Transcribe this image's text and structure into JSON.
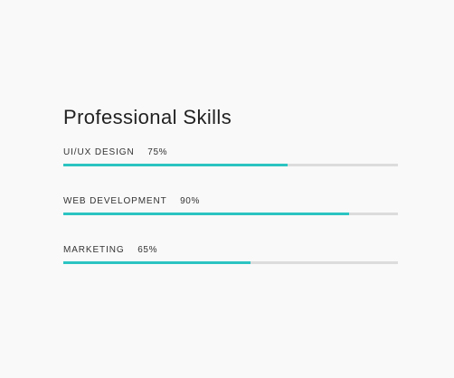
{
  "section": {
    "title": "Professional Skills"
  },
  "skills": [
    {
      "name": "UI/UX DESIGN",
      "percent_label": "75%",
      "level": 0.67
    },
    {
      "name": "WEB DEVELOPMENT",
      "percent_label": "90%",
      "level": 0.855
    },
    {
      "name": "MARKETING",
      "percent_label": "65%",
      "level": 0.56
    }
  ],
  "colors": {
    "accent": "#2cc4c2",
    "track": "#dcdcdc",
    "background": "#f9f9f9",
    "text": "#222222"
  }
}
